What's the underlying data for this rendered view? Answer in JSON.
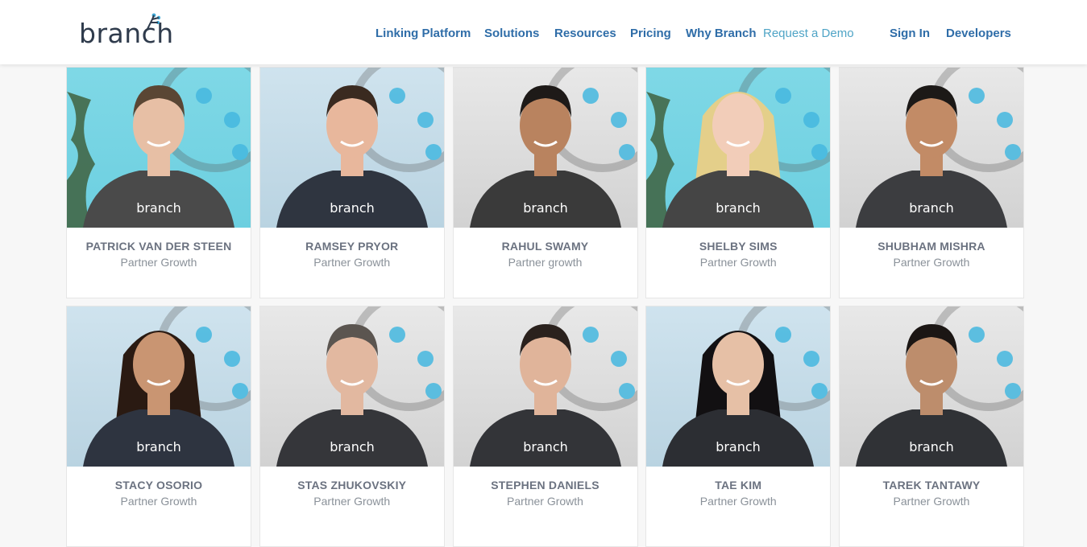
{
  "logo": {
    "text": "branch"
  },
  "nav": {
    "items": [
      {
        "label": "Linking Platform"
      },
      {
        "label": "Solutions"
      },
      {
        "label": "Resources"
      },
      {
        "label": "Pricing"
      },
      {
        "label": "Why Branch"
      },
      {
        "label": "Request a Demo"
      },
      {
        "label": "Sign In"
      },
      {
        "label": "Developers"
      }
    ]
  },
  "team": [
    {
      "name": "PATRICK VAN DER STEEN",
      "role": "Partner Growth"
    },
    {
      "name": "RAMSEY PRYOR",
      "role": "Partner Growth"
    },
    {
      "name": "RAHUL SWAMY",
      "role": "Partner growth"
    },
    {
      "name": "SHELBY SIMS",
      "role": "Partner Growth"
    },
    {
      "name": "SHUBHAM MISHRA",
      "role": "Partner Growth"
    },
    {
      "name": "STACY OSORIO",
      "role": "Partner Growth"
    },
    {
      "name": "STAS ZHUKOVSKIY",
      "role": "Partner Growth"
    },
    {
      "name": "STEPHEN DANIELS",
      "role": "Partner Growth"
    },
    {
      "name": "TAE KIM",
      "role": "Partner Growth"
    },
    {
      "name": "TAREK TANTAWY",
      "role": "Partner Growth"
    }
  ],
  "shirt_text": "branch",
  "colors": {
    "nav_link": "#2f6da8",
    "nav_link_light": "#4fa4c6",
    "logo": "#2f3b4c",
    "accent_cyan": "#6ccfe0"
  }
}
